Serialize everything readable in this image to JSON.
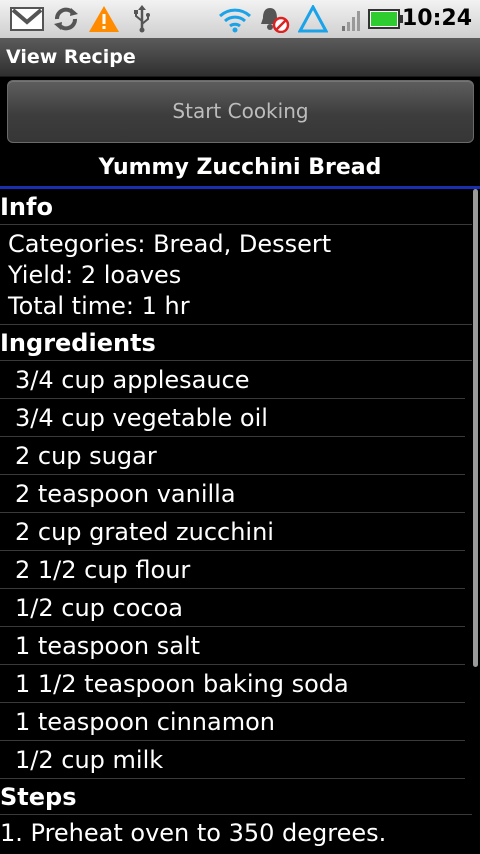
{
  "status_bar": {
    "icons": [
      "gmail-icon",
      "sync-icon",
      "warning-icon",
      "usb-icon",
      "wifi-icon",
      "alarm-muted-icon",
      "alert-triangle-icon",
      "signal-icon",
      "battery-icon"
    ],
    "time": "10:24"
  },
  "title_bar": {
    "title": "View Recipe"
  },
  "start_button": {
    "label": "Start Cooking"
  },
  "recipe": {
    "title": "Yummy Zucchini Bread"
  },
  "info": {
    "header": "Info",
    "categories": "Categories:  Bread, Dessert",
    "yield": "Yield:  2 loaves",
    "total_time": "Total time:  1 hr"
  },
  "ingredients": {
    "header": "Ingredients",
    "items": [
      "3/4 cup applesauce",
      "3/4 cup vegetable oil",
      "2 cup sugar",
      "2 teaspoon vanilla",
      "2 cup grated zucchini",
      "2 1/2 cup flour",
      "1/2 cup cocoa",
      "1 teaspoon salt",
      "1 1/2 teaspoon baking soda",
      "1 teaspoon cinnamon",
      "1/2 cup milk"
    ]
  },
  "steps": {
    "header": "Steps",
    "items": [
      "1. Preheat oven to 350 degrees."
    ]
  },
  "colors": {
    "background": "#000000",
    "title_underline": "#1b2fae",
    "battery": "#2ecc2e"
  }
}
